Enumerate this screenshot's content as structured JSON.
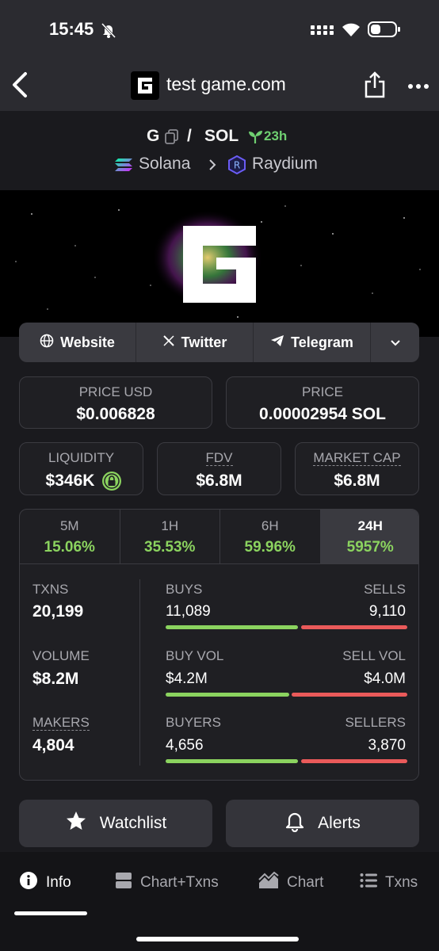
{
  "status_bar": {
    "time": "15:45"
  },
  "nav": {
    "title": "test game.com"
  },
  "pair": {
    "base": "G",
    "separator": "/",
    "quote": "SOL",
    "age": "23h",
    "chain": "Solana",
    "dex": "Raydium"
  },
  "links": [
    "Website",
    "Twitter",
    "Telegram"
  ],
  "metrics": {
    "price_usd_label": "PRICE USD",
    "price_usd": "$0.006828",
    "price_label": "PRICE",
    "price": "0.00002954 SOL",
    "liquidity_label": "LIQUIDITY",
    "liquidity": "$346K",
    "fdv_label": "FDV",
    "fdv": "$6.8M",
    "mcap_label": "MARKET CAP",
    "mcap": "$6.8M"
  },
  "timeframes": [
    {
      "label": "5M",
      "value": "15.06%"
    },
    {
      "label": "1H",
      "value": "35.53%"
    },
    {
      "label": "6H",
      "value": "59.96%"
    },
    {
      "label": "24H",
      "value": "5957%"
    }
  ],
  "stats": {
    "txns_label": "TXNS",
    "txns": "20,199",
    "volume_label": "VOLUME",
    "volume": "$8.2M",
    "makers_label": "MAKERS",
    "makers": "4,804",
    "buys_label": "BUYS",
    "buys": "11,089",
    "sells_label": "SELLS",
    "sells": "9,110",
    "buy_vol_label": "BUY VOL",
    "buy_vol": "$4.2M",
    "sell_vol_label": "SELL VOL",
    "sell_vol": "$4.0M",
    "buyers_label": "BUYERS",
    "buyers": "4,656",
    "sellers_label": "SELLERS",
    "sellers": "3,870"
  },
  "buttons": {
    "watchlist": "Watchlist",
    "alerts": "Alerts"
  },
  "bottom_nav": [
    "Info",
    "Chart+Txns",
    "Chart",
    "Txns"
  ],
  "colors": {
    "positive": "#8bd35f",
    "negative": "#ea5a5a",
    "age_green": "#6fcf71"
  }
}
